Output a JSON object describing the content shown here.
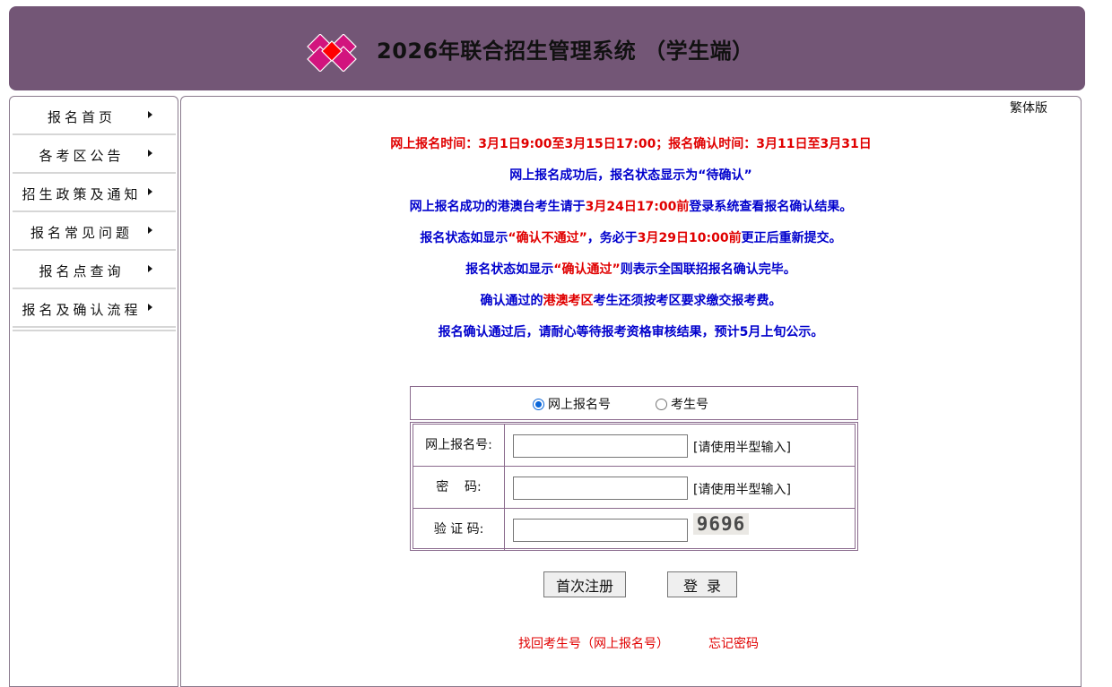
{
  "header": {
    "title": "2026年联合招生管理系统 （学生端）",
    "bg_color": "#735676"
  },
  "sidebar": {
    "items": [
      {
        "label": "报名首页"
      },
      {
        "label": "各考区公告"
      },
      {
        "label": "招生政策及通知"
      },
      {
        "label": "报名常见问题"
      },
      {
        "label": "报名点查询"
      },
      {
        "label": "报名及确认流程"
      }
    ]
  },
  "main": {
    "traditional_link": "繁体版",
    "notices": {
      "line1": "网上报名时间：3月1日9:00至3月15日17:00；报名确认时间：3月11日至3月31日",
      "line2": "网上报名成功后，报名状态显示为“待确认”",
      "line3_a": "网上报名成功的港澳台考生请于",
      "line3_b": "3月24日17:00前",
      "line3_c": "登录系统查看报名确认结果。",
      "line4_a": "报名状态如显示",
      "line4_b": "“确认不通过”",
      "line4_c": "，务必于",
      "line4_d": "3月29日10:00前",
      "line4_e": "更正后重新提交。",
      "line5_a": "报名状态如显示",
      "line5_b": "“确认通过”",
      "line5_c": "则表示全国联招报名确认完毕。",
      "line6_a": "确认通过的",
      "line6_b": "港澳考区",
      "line6_c": "考生还须按考区要求缴交报考费。",
      "line7": "报名确认通过后，请耐心等待报考资格审核结果，预计5月上旬公示。"
    },
    "login_type": {
      "option1": "网上报名号",
      "option2": "考生号",
      "selected": "网上报名号"
    },
    "form": {
      "reg_label": "网上报名号:",
      "reg_value": "",
      "reg_hint": "[请使用半型输入]",
      "pwd_label": "密    码:",
      "pwd_value": "",
      "pwd_hint": "[请使用半型输入]",
      "captcha_label": "验 证 码:",
      "captcha_value": "",
      "captcha_text": "9696"
    },
    "buttons": {
      "register": "首次注册",
      "login": "登录"
    },
    "links": {
      "recover_id": "找回考生号（网上报名号）",
      "forgot_password": "忘记密码"
    }
  },
  "colors": {
    "accent_red": "#e00000",
    "accent_blue": "#0000cc",
    "border": "#8a6a8d"
  }
}
